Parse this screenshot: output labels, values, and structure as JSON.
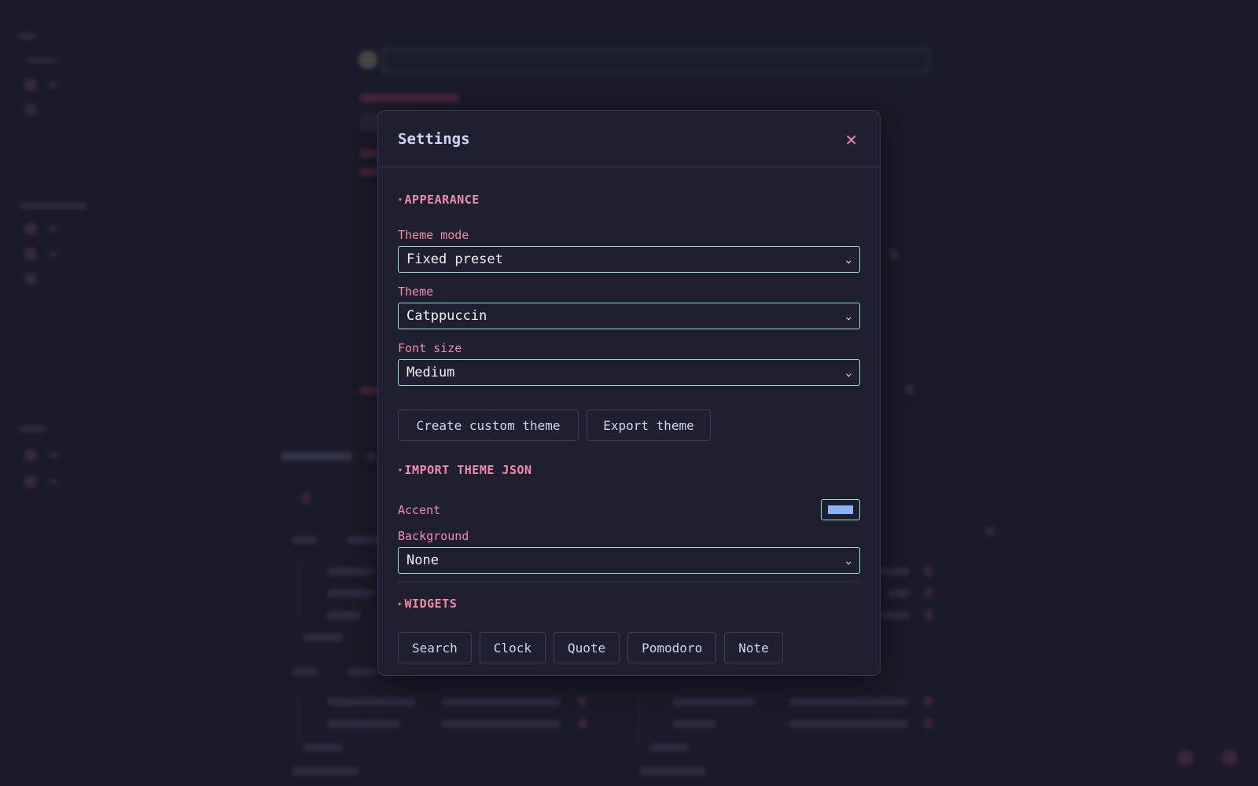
{
  "modal": {
    "title": "Settings",
    "close_icon": "close-icon",
    "close_glyph": "✕"
  },
  "appearance": {
    "header": "APPEARANCE",
    "caret": "▾",
    "theme_mode": {
      "label": "Theme mode",
      "value": "Fixed preset"
    },
    "theme": {
      "label": "Theme",
      "value": "Catppuccin"
    },
    "font_size": {
      "label": "Font size",
      "value": "Medium"
    },
    "buttons": {
      "create_custom_theme": "Create custom theme",
      "export_theme": "Export theme"
    }
  },
  "import_theme": {
    "header": "IMPORT THEME JSON",
    "caret": "▾",
    "accent_label": "Accent",
    "background": {
      "label": "Background",
      "value": "None"
    }
  },
  "widgets": {
    "header": "WIDGETS",
    "caret": "▸",
    "items": [
      "Search",
      "Clock",
      "Quote",
      "Pomodoro",
      "Note"
    ]
  },
  "colors": {
    "page_bg": "#1a1b28",
    "modal_bg": "#1e1f2f",
    "accent_pink": "#f38ba8",
    "accent_teal": "#94e2d5",
    "accent_swatch": "#89b4fa",
    "text": "#cdd6f4"
  }
}
